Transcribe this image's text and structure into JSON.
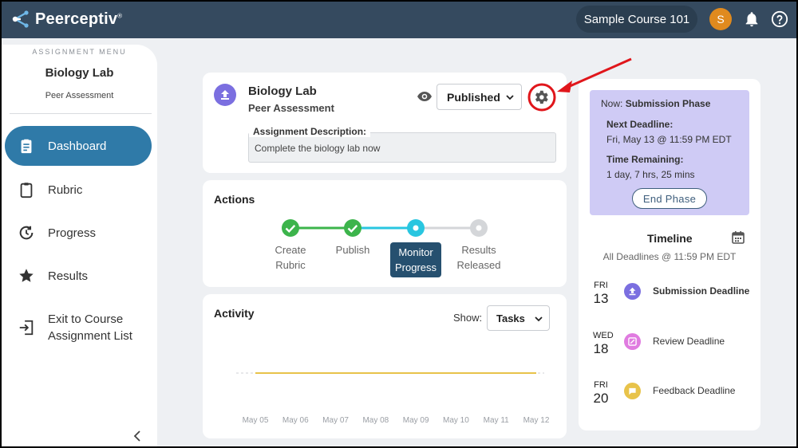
{
  "header": {
    "brand": "Peerceptiv",
    "brand_mark": "®",
    "course": "Sample Course 101",
    "avatar_initial": "S"
  },
  "sidebar": {
    "caption": "ASSIGNMENT MENU",
    "title": "Biology Lab",
    "subtitle": "Peer Assessment",
    "items": [
      {
        "label": "Dashboard",
        "icon": "clipboard-list-icon",
        "active": true
      },
      {
        "label": "Rubric",
        "icon": "clipboard-icon",
        "active": false
      },
      {
        "label": "Progress",
        "icon": "progress-clock-icon",
        "active": false
      },
      {
        "label": "Results",
        "icon": "star-icon",
        "active": false
      },
      {
        "label_line1": "Exit to Course",
        "label_line2": "Assignment List",
        "icon": "exit-icon",
        "active": false
      }
    ]
  },
  "assignment": {
    "title": "Biology Lab",
    "type": "Peer Assessment",
    "status": "Published",
    "description_label": "Assignment Description:",
    "description": "Complete the biology lab now"
  },
  "actions": {
    "heading": "Actions",
    "steps": [
      {
        "line1": "Create",
        "line2": "Rubric",
        "state": "done"
      },
      {
        "line1": "Publish",
        "line2": "",
        "state": "done"
      },
      {
        "line1": "Monitor",
        "line2": "Progress",
        "state": "current"
      },
      {
        "line1": "Results",
        "line2": "Released",
        "state": "pending"
      }
    ]
  },
  "activity": {
    "heading": "Activity",
    "show_label": "Show:",
    "show_value": "Tasks",
    "chart_data": {
      "type": "line",
      "x": [
        "May 05",
        "May 06",
        "May 07",
        "May 08",
        "May 09",
        "May 10",
        "May 11",
        "May 12"
      ],
      "series": [
        {
          "values": [
            0,
            0,
            0,
            0,
            0,
            0,
            0,
            0
          ],
          "color": "#e8c34a"
        }
      ],
      "grid": false
    }
  },
  "phase": {
    "now_prefix": "Now:",
    "now_value": "Submission Phase",
    "next_deadline_label": "Next Deadline:",
    "next_deadline": "Fri, May 13 @ 11:59 PM EDT",
    "time_remaining_label": "Time Remaining:",
    "time_remaining": "1 day, 7 hrs, 25 mins",
    "end_button": "End Phase"
  },
  "timeline": {
    "heading": "Timeline",
    "subtitle": "All Deadlines @ 11:59 PM EDT",
    "rows": [
      {
        "dow": "FRI",
        "day": "13",
        "name": "Submission Deadline",
        "color": "#7b6fe0",
        "icon": "upload-icon",
        "bold": true
      },
      {
        "dow": "WED",
        "day": "18",
        "name": "Review Deadline",
        "color": "#e07be0",
        "icon": "review-icon",
        "bold": false
      },
      {
        "dow": "FRI",
        "day": "20",
        "name": "Feedback Deadline",
        "color": "#e8c34a",
        "icon": "chat-icon",
        "bold": false
      }
    ]
  },
  "colors": {
    "header_bg": "#354a5f",
    "active_nav": "#2f7aa8",
    "done_step": "#3cb44b",
    "current_step": "#29c6e0",
    "annotation": "#e0161b"
  }
}
